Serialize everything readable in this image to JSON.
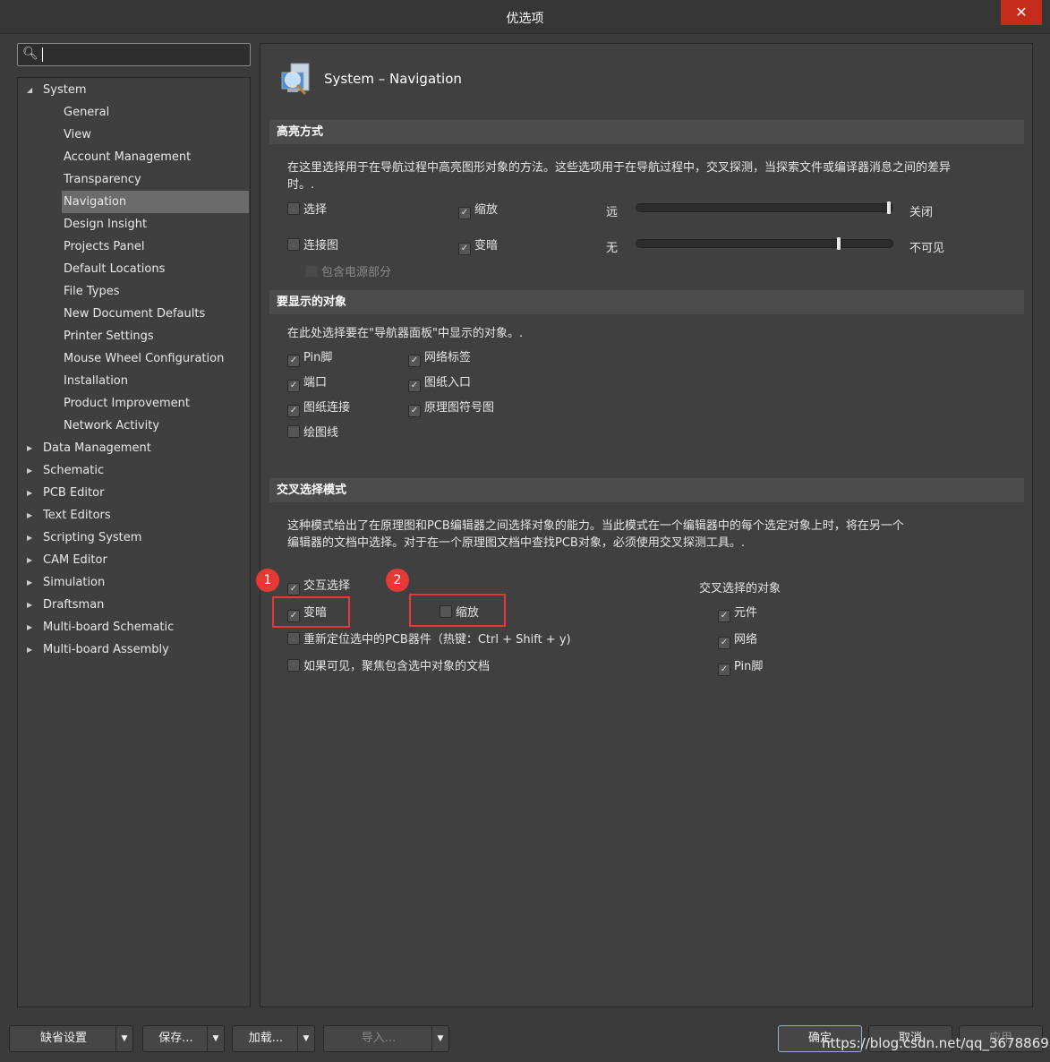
{
  "window": {
    "title": "优选项",
    "close_icon": "close-icon"
  },
  "search": {
    "value": "",
    "icon": "search-icon"
  },
  "tree": {
    "items": [
      {
        "label": "System",
        "level": 0,
        "expanded": true
      },
      {
        "label": "General",
        "level": 1
      },
      {
        "label": "View",
        "level": 1
      },
      {
        "label": "Account Management",
        "level": 1
      },
      {
        "label": "Transparency",
        "level": 1
      },
      {
        "label": "Navigation",
        "level": 1,
        "selected": true
      },
      {
        "label": "Design Insight",
        "level": 1
      },
      {
        "label": "Projects Panel",
        "level": 1
      },
      {
        "label": "Default Locations",
        "level": 1
      },
      {
        "label": "File Types",
        "level": 1
      },
      {
        "label": "New Document Defaults",
        "level": 1
      },
      {
        "label": "Printer Settings",
        "level": 1
      },
      {
        "label": "Mouse Wheel Configuration",
        "level": 1
      },
      {
        "label": "Installation",
        "level": 1
      },
      {
        "label": "Product Improvement",
        "level": 1
      },
      {
        "label": "Network Activity",
        "level": 1
      },
      {
        "label": "Data Management",
        "level": 0
      },
      {
        "label": "Schematic",
        "level": 0
      },
      {
        "label": "PCB Editor",
        "level": 0
      },
      {
        "label": "Text Editors",
        "level": 0
      },
      {
        "label": "Scripting System",
        "level": 0
      },
      {
        "label": "CAM Editor",
        "level": 0
      },
      {
        "label": "Simulation",
        "level": 0
      },
      {
        "label": "Draftsman",
        "level": 0
      },
      {
        "label": "Multi-board Schematic",
        "level": 0
      },
      {
        "label": "Multi-board Assembly",
        "level": 0
      }
    ]
  },
  "page": {
    "title": "System – Navigation",
    "icon": "navigation-magnifier-icon"
  },
  "highlight": {
    "header": "高亮方式",
    "desc1": "在这里选择用于在导航过程中高亮图形对象的方法。这些选项用于在导航过程中，交叉探测，当探索文件或编译器消息之间的差异",
    "desc2": "时。.",
    "select": {
      "label": "选择",
      "checked": false
    },
    "zoom": {
      "label": "缩放",
      "checked": true
    },
    "connect": {
      "label": "连接图",
      "checked": false
    },
    "dim": {
      "label": "变暗",
      "checked": true
    },
    "power": {
      "label": "包含电源部分",
      "checked": false,
      "disabled": true
    },
    "slider1": {
      "left": "远",
      "right": "关闭",
      "value_percent": 100
    },
    "slider2": {
      "left": "无",
      "right": "不可见",
      "value_percent": 80
    }
  },
  "objects": {
    "header": "要显示的对象",
    "desc": "在此处选择要在\"导航器面板\"中显示的对象。.",
    "items": [
      {
        "label": "Pin脚",
        "checked": true
      },
      {
        "label": "网络标签",
        "checked": true
      },
      {
        "label": "端口",
        "checked": true
      },
      {
        "label": "图纸入口",
        "checked": true
      },
      {
        "label": "图纸连接",
        "checked": true
      },
      {
        "label": "原理图符号图",
        "checked": true
      },
      {
        "label": "绘图线",
        "checked": false
      }
    ]
  },
  "cross": {
    "header": "交叉选择模式",
    "desc1": "这种模式给出了在原理图和PCB编辑器之间选择对象的能力。当此模式在一个编辑器中的每个选定对象上时，将在另一个",
    "desc2": "编辑器的文档中选择。对于在一个原理图文档中查找PCB对象，必须使用交叉探测工具。.",
    "interactive": {
      "label": "交互选择",
      "checked": true
    },
    "dim": {
      "label": "变暗",
      "checked": true
    },
    "zoom": {
      "label": "缩放",
      "checked": false
    },
    "reposition": {
      "label": "重新定位选中的PCB器件（热键：Ctrl + Shift + y)",
      "checked": false
    },
    "focus": {
      "label": "如果可见，聚焦包含选中对象的文档",
      "checked": false
    },
    "objects_label": "交叉选择的对象",
    "objects": [
      {
        "label": "元件",
        "checked": true
      },
      {
        "label": "网络",
        "checked": true
      },
      {
        "label": "Pin脚",
        "checked": true
      }
    ],
    "annotations": [
      "1",
      "2"
    ],
    "annotation_color": "#e53935"
  },
  "footer": {
    "defaults": "缺省设置",
    "save": "保存...",
    "load": "加载...",
    "import": "导入...",
    "ok": "确定",
    "cancel": "取消",
    "apply": "应用"
  },
  "watermark": "https://blog.csdn.net/qq_36788698"
}
